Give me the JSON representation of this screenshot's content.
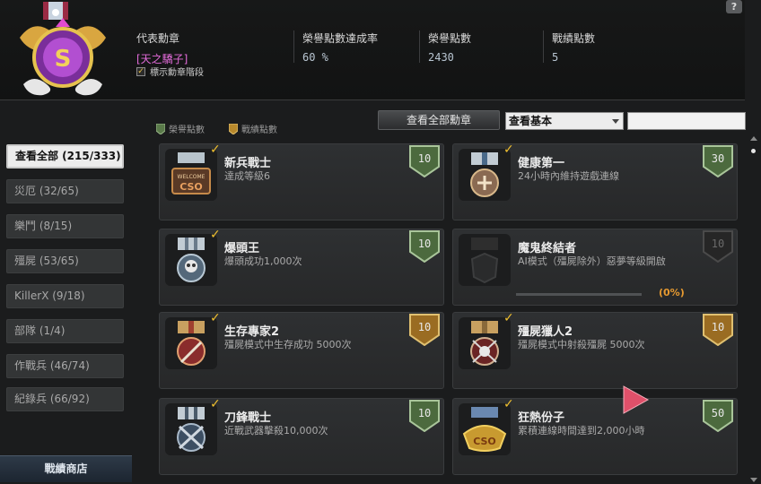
{
  "header": {
    "help_label": "?",
    "representative_label": "代表勳章",
    "representative_value": "[天之驕子]",
    "rate_label": "榮譽點數達成率",
    "rate_value": "60 %",
    "honor_label": "榮譽點數",
    "honor_value": "2430",
    "battle_label": "戰績點數",
    "battle_value": "5",
    "show_stage_label": "標示勳章階段",
    "show_stage_checked": true
  },
  "toolbar": {
    "legend_honor": "榮譽點數",
    "legend_battle": "戰績點數",
    "view_all_label": "查看全部勳章",
    "select_value": "查看基本",
    "search_value": ""
  },
  "sidebar": {
    "items": [
      {
        "label": "查看全部 (215/333)",
        "active": true
      },
      {
        "label": "災厄 (32/65)",
        "active": false
      },
      {
        "label": "樂鬥 (8/15)",
        "active": false
      },
      {
        "label": "殭屍 (53/65)",
        "active": false
      },
      {
        "label": "KillerX (9/18)",
        "active": false
      },
      {
        "label": "部隊 (1/4)",
        "active": false
      },
      {
        "label": "作戰兵 (46/74)",
        "active": false
      },
      {
        "label": "紀錄兵 (66/92)",
        "active": false
      }
    ],
    "shop_label": "戰績商店"
  },
  "colors": {
    "honor_green": "#5a7a4a",
    "battle_gold": "#b8892c",
    "locked_gray": "#3a3a3a",
    "progress_orange": "#e79a30"
  },
  "achievements": [
    {
      "name": "新兵戰士",
      "desc": "達成等級6",
      "points": "10",
      "badge": "green",
      "medal": "welcome-medal-icon",
      "done": true
    },
    {
      "name": "健康第一",
      "desc": "24小時內維持遊戲連線",
      "points": "30",
      "badge": "green",
      "medal": "health-medal-icon",
      "done": true
    },
    {
      "name": "爆頭王",
      "desc": "爆頭成功1,000次",
      "points": "10",
      "badge": "green",
      "medal": "skull-medal-icon",
      "done": true
    },
    {
      "name": "魔鬼終結者",
      "desc": "AI模式（殭屍除外）惡夢等級開啟",
      "points": "10",
      "badge": "locked",
      "medal": "demon-medal-icon",
      "done": false,
      "progress": 0,
      "progress_text": "(0%)"
    },
    {
      "name": "生存專家2",
      "desc": "殭屍模式中生存成功 5000次",
      "points": "10",
      "badge": "gold",
      "medal": "survival-medal-icon",
      "done": true
    },
    {
      "name": "殭屍獵人2",
      "desc": "殭屍模式中射殺殭屍 5000次",
      "points": "10",
      "badge": "gold",
      "medal": "zombie-hunter-medal-icon",
      "done": true
    },
    {
      "name": "刀鋒戰士",
      "desc": "近戰武器擊殺10,000次",
      "points": "10",
      "badge": "green",
      "medal": "blade-medal-icon",
      "done": true
    },
    {
      "name": "狂熱份子",
      "desc": "累積連線時間達到2,000小時",
      "points": "50",
      "badge": "green",
      "medal": "fanatic-medal-icon",
      "done": true
    }
  ]
}
